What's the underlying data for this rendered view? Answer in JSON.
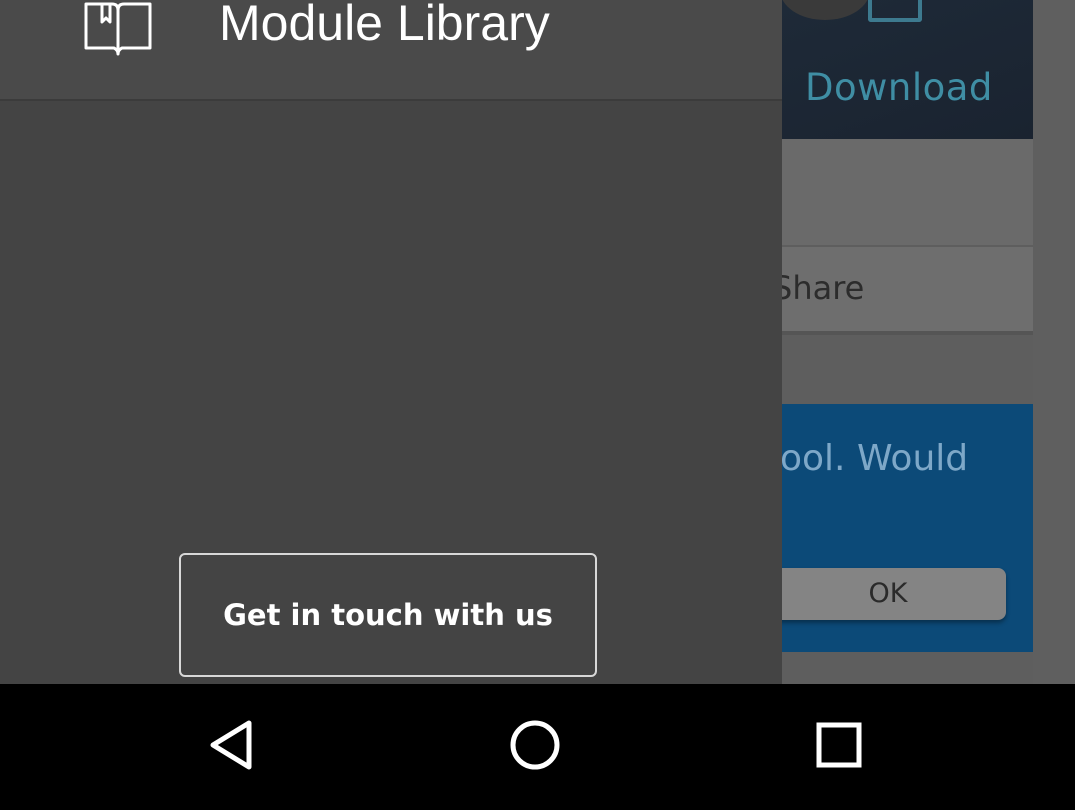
{
  "background_app": {
    "download_label": "Download",
    "share_label": "Share",
    "notice_text": "ool. Would",
    "ok_label": "OK"
  },
  "drawer": {
    "title": "Module Library",
    "title_icon": "open-book-icon",
    "contact_button_label": "Get in touch with us"
  },
  "navbar": {
    "back_icon": "back-triangle-icon",
    "home_icon": "home-circle-icon",
    "recents_icon": "recents-square-icon"
  },
  "colors": {
    "drawer_bg": "#444444",
    "notice_bg": "#0c4a78",
    "download_text": "#3f8ea4",
    "navbar_bg": "#000000"
  }
}
